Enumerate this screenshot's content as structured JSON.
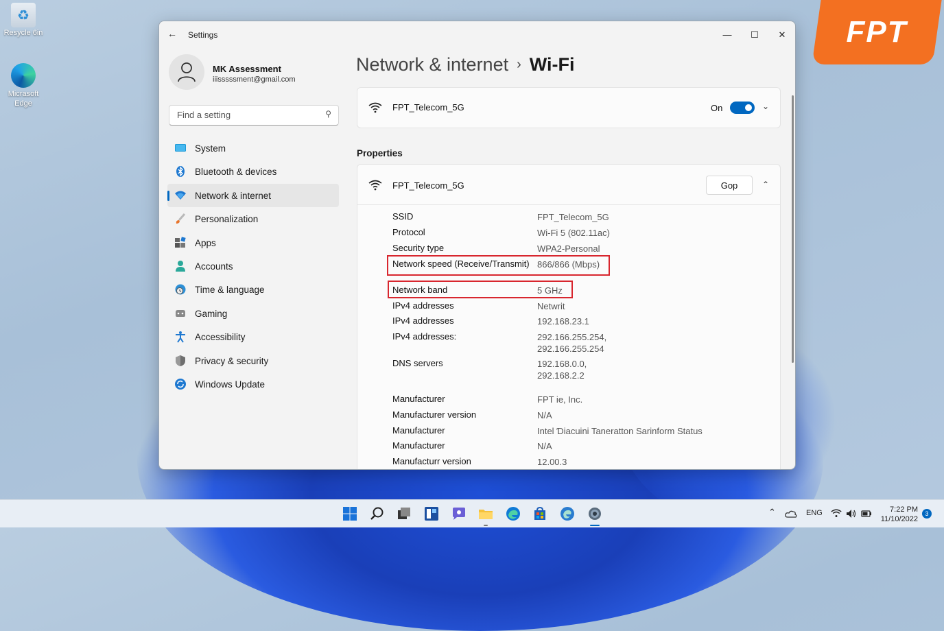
{
  "desktop": {
    "recycle_bin_label": "Resycle 6in",
    "edge_label": "Micrasoft Edge",
    "brand_logo": "FPT"
  },
  "window": {
    "title": "Settings",
    "back_icon": "back-arrow-icon",
    "controls": [
      "minimize",
      "maximize",
      "close"
    ]
  },
  "profile": {
    "name": "MK Assessment",
    "email": "iiisssssment@gmail.com"
  },
  "search": {
    "placeholder": "Find a setting"
  },
  "sidebar": {
    "items": [
      {
        "label": "System",
        "icon": "system-icon",
        "active": false
      },
      {
        "label": "Bluetooth & devices",
        "icon": "bluetooth-icon",
        "active": false
      },
      {
        "label": "Network & internet",
        "icon": "wifi-icon",
        "active": true
      },
      {
        "label": "Personalization",
        "icon": "brush-icon",
        "active": false
      },
      {
        "label": "Apps",
        "icon": "apps-icon",
        "active": false
      },
      {
        "label": "Accounts",
        "icon": "account-icon",
        "active": false
      },
      {
        "label": "Time & language",
        "icon": "globe-clock-icon",
        "active": false
      },
      {
        "label": "Gaming",
        "icon": "gamepad-icon",
        "active": false
      },
      {
        "label": "Accessibility",
        "icon": "accessibility-icon",
        "active": false
      },
      {
        "label": "Privacy & security",
        "icon": "shield-icon",
        "active": false
      },
      {
        "label": "Windows Update",
        "icon": "update-icon",
        "active": false
      }
    ]
  },
  "breadcrumb": {
    "parent": "Network & internet",
    "separator": "›",
    "current": "Wi-Fi"
  },
  "wifi_card": {
    "ssid": "FPT_Telecom_5G",
    "toggle_label": "On",
    "toggle_on": true
  },
  "properties": {
    "title": "Properties",
    "ssid": "FPT_Telecom_5G",
    "copy_label": "Gop",
    "rows": [
      {
        "key": "SSID",
        "value": "FPT_Telecom_5G"
      },
      {
        "key": "Protocol",
        "value": "Wi-Fi 5 (802.11ac)"
      },
      {
        "key": "Security type",
        "value": "WPA2-Personal"
      },
      {
        "key": "Network speed (Receive/Transmit)",
        "value": "866/866 (Mbps)"
      },
      {
        "key": "Network band",
        "value": "5 GHz"
      },
      {
        "key": "IPv4 addresses",
        "value": "Netwrit"
      },
      {
        "key": "IPv4 addresses",
        "value": "192.168.23.1"
      },
      {
        "key": "IPv4 addresses:",
        "value": "292.166.255.254,\n292.166.255.254"
      },
      {
        "key": "DNS servers",
        "value": "192.168.0.0,\n292.168.2.2"
      },
      {
        "key": "Manufacturer",
        "value": "FPT ie, Inc."
      },
      {
        "key": "Manufacturer version",
        "value": "N/A"
      },
      {
        "key": "Manufacturer",
        "value": "Intel Ɗiacuini Taneratton Sarinform Status"
      },
      {
        "key": "Manufacturer",
        "value": "N/A"
      },
      {
        "key": "Manufacturr version",
        "value": "12.00.3"
      }
    ],
    "highlight_color": "#d8262e"
  },
  "taskbar": {
    "apps": [
      "start-icon",
      "search-icon",
      "task-view-icon",
      "widgets-icon",
      "chat-icon",
      "file-explorer-icon",
      "edge-icon",
      "store-icon",
      "edge-beta-icon",
      "settings-icon"
    ],
    "language": "ENG",
    "time": "7:22 PM",
    "date": "11/10/2022",
    "notification_count": "3"
  },
  "colors": {
    "accent": "#0067c0",
    "brand": "#f37021"
  }
}
